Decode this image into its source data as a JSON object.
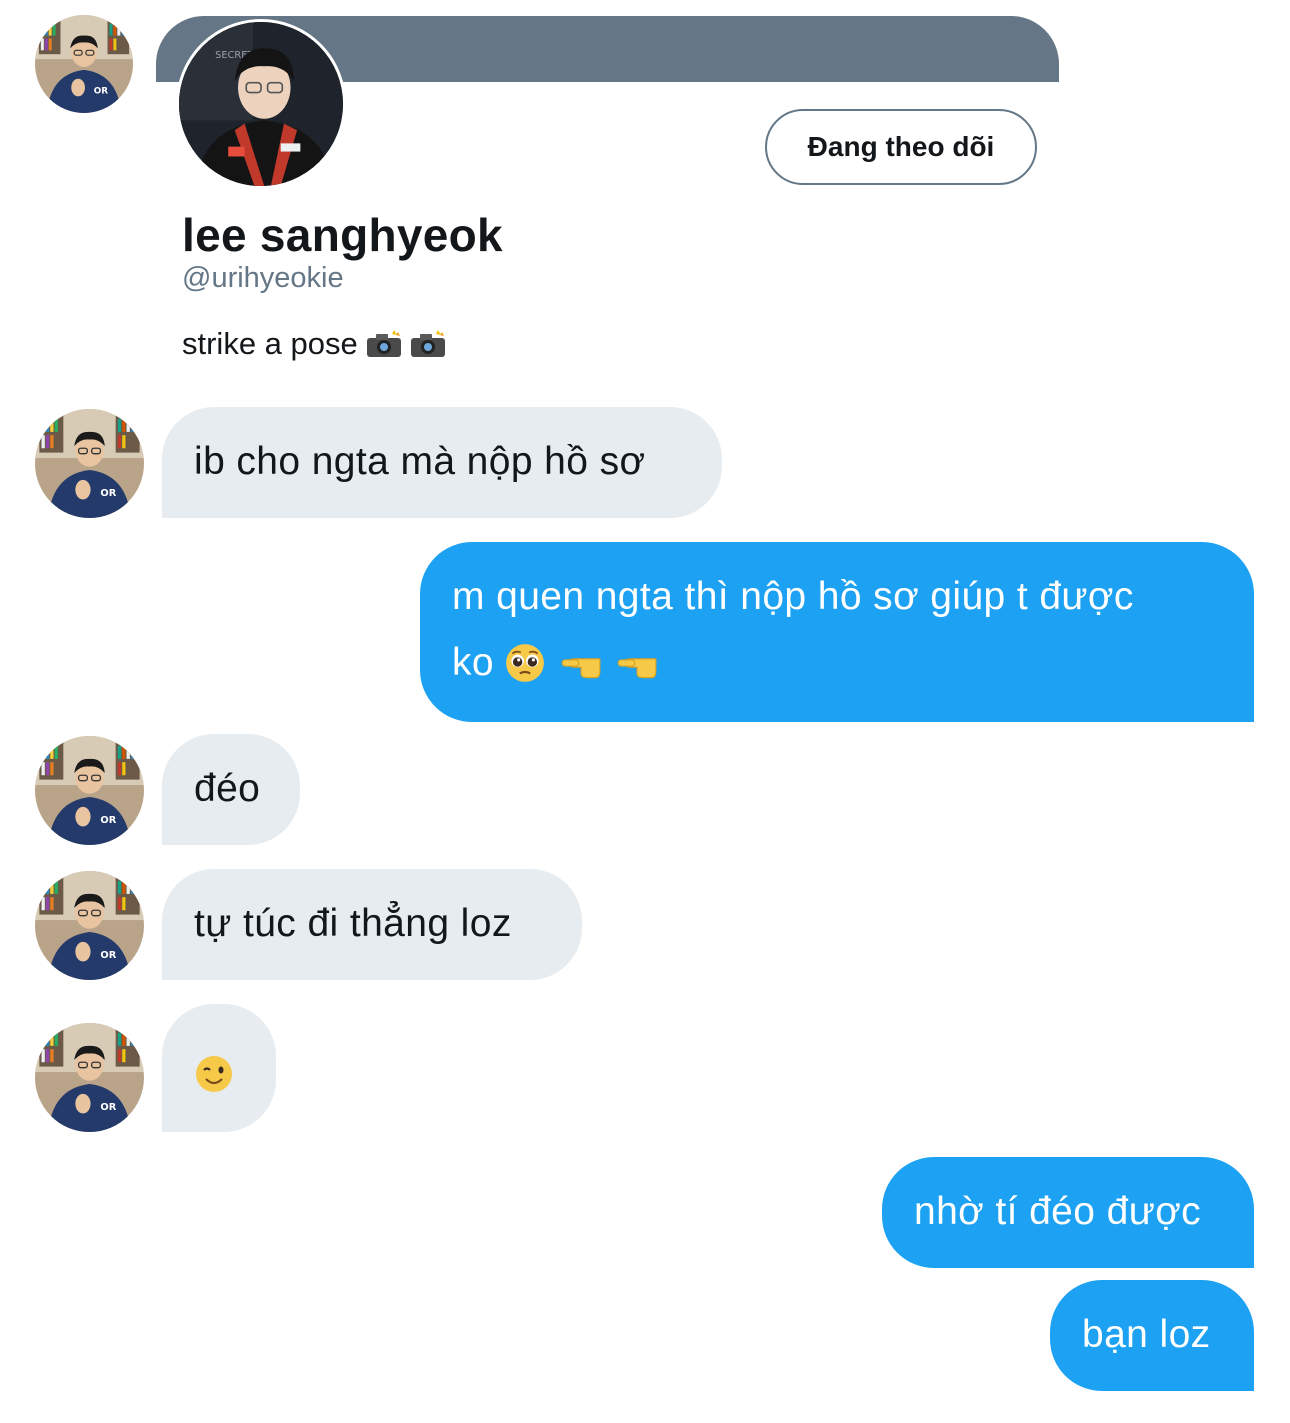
{
  "profile": {
    "name": "lee sanghyeok",
    "handle": "@urihyeokie",
    "bio": "strike a pose",
    "bio_icons": [
      "camera-flash-icon",
      "camera-flash-icon"
    ],
    "follow_label": "Đang theo dõi"
  },
  "messages": [
    {
      "from": "them",
      "text": "ib cho ngta mà nộp hồ sơ"
    },
    {
      "from": "me",
      "line1": "m quen ngta thì nộp hồ sơ giúp t được",
      "line2": "ko",
      "icons": [
        "pleading-face-icon",
        "pointing-left-icon",
        "pointing-left-icon"
      ]
    },
    {
      "from": "them",
      "text": "đéo"
    },
    {
      "from": "them",
      "text": "tự túc đi thẳng loz"
    },
    {
      "from": "them",
      "icon": "winking-face-icon"
    },
    {
      "from": "me",
      "text": "nhờ tí đéo được"
    },
    {
      "from": "me",
      "text": "bạn loz"
    }
  ],
  "colors": {
    "sent_bubble": "#1da1f2",
    "received_bubble": "#e6ecf0",
    "header_card": "#657786"
  }
}
